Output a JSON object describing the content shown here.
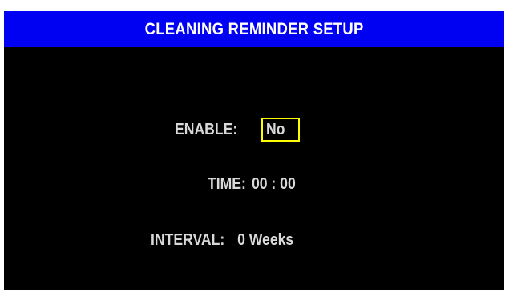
{
  "header": {
    "title": "CLEANING REMINDER SETUP"
  },
  "enable": {
    "label": "ENABLE:",
    "value": "No"
  },
  "time": {
    "label": "TIME:",
    "value": "00 : 00"
  },
  "interval": {
    "label": "INTERVAL:",
    "value": "0 Weeks"
  },
  "colors": {
    "title_bar": "#0000f2",
    "background": "#000000",
    "text": "#d9d9d9",
    "selection_border": "#ffff00"
  }
}
